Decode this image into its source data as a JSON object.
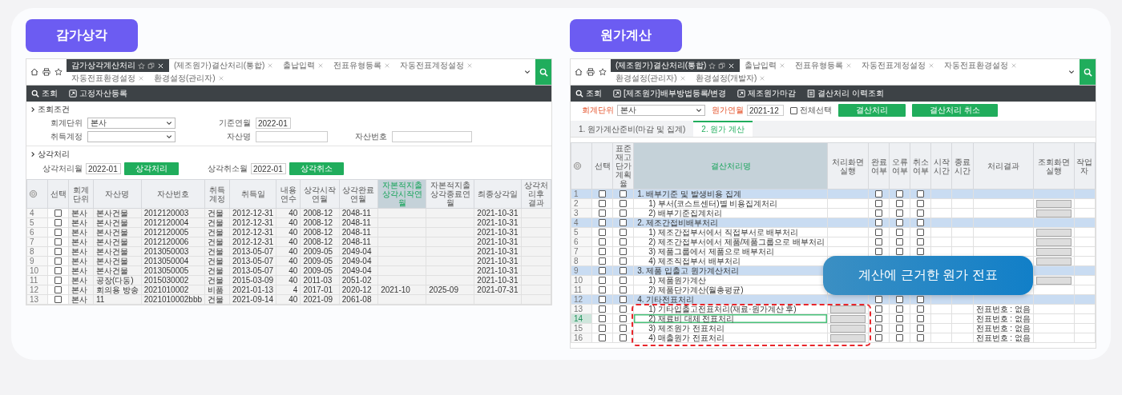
{
  "depreciation": {
    "title": "감가상각",
    "tabs": [
      {
        "label": "감가상각계산처리",
        "selected": true
      },
      {
        "label": "(제조원가)결산처리(통합)",
        "selected": false
      },
      {
        "label": "출납입력",
        "selected": false
      },
      {
        "label": "전표유형등록",
        "selected": false
      },
      {
        "label": "자동전표계정설정",
        "selected": false
      },
      {
        "label": "자동전표환경설정",
        "selected": false
      },
      {
        "label": "환경설정(관리자)",
        "selected": false
      }
    ],
    "toolbar": [
      {
        "kind": "search",
        "label": "조회"
      },
      {
        "kind": "form",
        "label": "고정자산등록"
      }
    ],
    "query": {
      "heading": "조회조건",
      "rows": [
        [
          {
            "label": "회계단위",
            "kind": "select",
            "value": "본사"
          },
          {
            "label": "기준연월",
            "kind": "input",
            "value": "2022-01"
          }
        ],
        [
          {
            "label": "취득계정",
            "kind": "select"
          },
          {
            "label": "자산명",
            "kind": "input"
          },
          {
            "label": "자산번호",
            "kind": "input"
          }
        ]
      ]
    },
    "process": {
      "heading": "상각처리",
      "fields": [
        {
          "label": "상각처리월",
          "value": "2022-01",
          "button": "상각처리"
        },
        {
          "label": "상각취소월",
          "value": "2022-01",
          "button": "상각취소"
        }
      ]
    },
    "table": {
      "select_header": "선택",
      "columns": [
        {
          "label": "회계단위",
          "highlighted": false
        },
        {
          "label": "자산명",
          "highlighted": false
        },
        {
          "label": "자산번호",
          "highlighted": false
        },
        {
          "label": "취득계정",
          "highlighted": false
        },
        {
          "label": "취득일",
          "highlighted": false
        },
        {
          "label": "내용연수",
          "highlighted": false
        },
        {
          "label": "상각시작연월",
          "highlighted": false
        },
        {
          "label": "상각완료연월",
          "highlighted": false
        },
        {
          "label": "자본적지출 상각시작연월",
          "highlighted": true
        },
        {
          "label": "자본적지출 상각종료연월",
          "highlighted": false
        },
        {
          "label": "최종상각일",
          "highlighted": false
        },
        {
          "label": "상각처리후 결과",
          "highlighted": false
        }
      ],
      "rows": [
        {
          "no": "4",
          "checked": false,
          "cells": [
            "본사",
            "본사건물",
            "2012120003",
            "건물",
            "2012-12-31",
            "40",
            "2008-12",
            "2048-11",
            null,
            null,
            "2021-10-31",
            null
          ]
        },
        {
          "no": "5",
          "checked": false,
          "cells": [
            "본사",
            "본사건물",
            "2012120004",
            "건물",
            "2012-12-31",
            "40",
            "2008-12",
            "2048-11",
            null,
            null,
            "2021-10-31",
            null
          ]
        },
        {
          "no": "6",
          "checked": false,
          "cells": [
            "본사",
            "본사건물",
            "2012120005",
            "건물",
            "2012-12-31",
            "40",
            "2008-12",
            "2048-11",
            null,
            null,
            "2021-10-31",
            null
          ]
        },
        {
          "no": "7",
          "checked": false,
          "cells": [
            "본사",
            "본사건물",
            "2012120006",
            "건물",
            "2012-12-31",
            "40",
            "2008-12",
            "2048-11",
            null,
            null,
            "2021-10-31",
            null
          ]
        },
        {
          "no": "8",
          "checked": false,
          "cells": [
            "본사",
            "본사건물",
            "2013050003",
            "건물",
            "2013-05-07",
            "40",
            "2009-05",
            "2049-04",
            null,
            null,
            "2021-10-31",
            null
          ]
        },
        {
          "no": "9",
          "checked": false,
          "cells": [
            "본사",
            "본사건물",
            "2013050004",
            "건물",
            "2013-05-07",
            "40",
            "2009-05",
            "2049-04",
            null,
            null,
            "2021-10-31",
            null
          ]
        },
        {
          "no": "10",
          "checked": false,
          "cells": [
            "본사",
            "본사건물",
            "2013050005",
            "건물",
            "2013-05-07",
            "40",
            "2009-05",
            "2049-04",
            null,
            null,
            "2021-10-31",
            null
          ]
        },
        {
          "no": "11",
          "checked": false,
          "cells": [
            "본사",
            "공장(다동)",
            "2015030002",
            "건물",
            "2015-03-09",
            "40",
            "2011-03",
            "2051-02",
            null,
            null,
            "2021-10-31",
            null
          ]
        },
        {
          "no": "12",
          "checked": false,
          "cells": [
            "본사",
            "회의용 방송",
            "2021010002",
            "비품",
            "2021-01-13",
            "4",
            "2017-01",
            "2020-12",
            "2021-10",
            "2025-09",
            "2021-07-31",
            null
          ]
        },
        {
          "no": "13",
          "checked": false,
          "cells": [
            "본사",
            "11",
            "2021010002bbb",
            "건물",
            "2021-09-14",
            "40",
            "2021-09",
            "2061-08",
            null,
            null,
            null,
            null
          ]
        }
      ]
    }
  },
  "costing": {
    "title": "원가계산",
    "tabs": [
      {
        "label": "(제조원가)결산처리(통합)",
        "selected": true
      },
      {
        "label": "출납입력",
        "selected": false
      },
      {
        "label": "전표유형등록",
        "selected": false
      },
      {
        "label": "자동전표계정설정",
        "selected": false
      },
      {
        "label": "자동전표환경설정",
        "selected": false
      },
      {
        "label": "환경설정(관리자)",
        "selected": false
      },
      {
        "label": "환경설정(개발자)",
        "selected": false
      }
    ],
    "toolbar": [
      {
        "kind": "search",
        "label": "조회"
      },
      {
        "kind": "form",
        "label": "[제조원가]배부방법등록/변경"
      },
      {
        "kind": "form",
        "label": "제조원가마감"
      },
      {
        "kind": "list",
        "label": "결산처리 이력조회"
      }
    ],
    "filters": {
      "fields": [
        {
          "label": "회계단위",
          "kind": "select",
          "value": "본사",
          "required": true
        },
        {
          "label": "원가연월",
          "kind": "input",
          "value": "2021-12",
          "required": true
        }
      ],
      "select_all": {
        "label": "전체선택",
        "checked": false
      },
      "buttons": [
        "결산처리",
        "결산처리 취소"
      ]
    },
    "subtabs": [
      {
        "label": "1. 원가계산준비(마감 및 집계)",
        "selected": false
      },
      {
        "label": "2. 원가 계산",
        "selected": true
      }
    ],
    "table": {
      "columns": [
        {
          "label": "선택",
          "highlighted": false
        },
        {
          "label": "표준재고단가 계획율",
          "highlighted": false
        },
        {
          "label": "결산처리명",
          "highlighted": true
        },
        {
          "label": "처리화면실행",
          "highlighted": false
        },
        {
          "label": "완료여부",
          "highlighted": false
        },
        {
          "label": "오류여부",
          "highlighted": false
        },
        {
          "label": "취소여부",
          "highlighted": false
        },
        {
          "label": "시작시간",
          "highlighted": false
        },
        {
          "label": "종료시간",
          "highlighted": false
        },
        {
          "label": "처리결과",
          "highlighted": false
        },
        {
          "label": "조회화면실행",
          "highlighted": false
        },
        {
          "label": "작업자",
          "highlighted": false
        }
      ],
      "rows": [
        {
          "no": "1",
          "kind": "group",
          "label": "1. 배부기준 및 발생비용 집계",
          "selected": false,
          "select_checked": false,
          "plan_checked": false,
          "done": false,
          "error": false,
          "cancel": false,
          "run_button": false,
          "view_button": false
        },
        {
          "no": "2",
          "kind": "item",
          "label": "1) 부서(코스트센터)별 비용집계처리",
          "selected": false,
          "select_checked": false,
          "plan_checked": false,
          "done": false,
          "error": false,
          "cancel": false,
          "run_button": false,
          "view_button": true
        },
        {
          "no": "3",
          "kind": "item",
          "label": "2) 배부기준집계처리",
          "selected": false,
          "select_checked": false,
          "plan_checked": false,
          "done": false,
          "error": false,
          "cancel": false,
          "run_button": false,
          "view_button": true
        },
        {
          "no": "4",
          "kind": "group",
          "label": "2. 제조간접비배부처리",
          "selected": false,
          "select_checked": false,
          "plan_checked": false,
          "done": false,
          "error": false,
          "cancel": false,
          "run_button": false,
          "view_button": false
        },
        {
          "no": "5",
          "kind": "item",
          "label": "1) 제조간접부서에서 직접부서로 배부처리",
          "selected": false,
          "select_checked": false,
          "plan_checked": false,
          "done": false,
          "error": false,
          "cancel": false,
          "run_button": false,
          "view_button": true
        },
        {
          "no": "6",
          "kind": "item",
          "label": "2) 제조간접부서에서 제품/제품그룹으로 배부처리",
          "selected": false,
          "select_checked": false,
          "plan_checked": false,
          "done": false,
          "error": false,
          "cancel": false,
          "run_button": false,
          "view_button": true
        },
        {
          "no": "7",
          "kind": "item",
          "label": "3) 제품그룹에서 제품으로 배부처리",
          "selected": false,
          "select_checked": false,
          "plan_checked": false,
          "done": false,
          "error": false,
          "cancel": false,
          "run_button": false,
          "view_button": true
        },
        {
          "no": "8",
          "kind": "item",
          "label": "4) 제조직접부서 배부처리",
          "selected": false,
          "select_checked": false,
          "plan_checked": false,
          "run_button": false,
          "view_button": true
        },
        {
          "no": "9",
          "kind": "group",
          "label": "3. 제품 입출고 원가계산처리",
          "selected": false,
          "select_checked": false,
          "plan_checked": false,
          "run_button": false,
          "view_button": false
        },
        {
          "no": "10",
          "kind": "item",
          "label": "1) 제품원가계산",
          "selected": false,
          "select_checked": false,
          "plan_checked": false,
          "run_button": false,
          "view_button": true
        },
        {
          "no": "11",
          "kind": "item",
          "label": "2) 제품단가계산(월총평균)",
          "selected": false,
          "select_checked": false,
          "plan_checked": false,
          "run_button": false,
          "view_button": false
        },
        {
          "no": "12",
          "kind": "group",
          "label": "4. 기타전표처리",
          "selected": false,
          "select_checked": false,
          "plan_checked": false,
          "done": false,
          "error": false,
          "cancel": false,
          "run_button": false,
          "view_button": false
        },
        {
          "no": "13",
          "kind": "item",
          "label": "1) 기타입출고전표처리(재료·원가계산 후)",
          "selected": false,
          "select_checked": false,
          "plan_checked": false,
          "done": false,
          "error": false,
          "cancel": false,
          "run_button": true,
          "view_button": false,
          "result": "전표번호 : 없음"
        },
        {
          "no": "14",
          "kind": "item",
          "label": "2) 재료비 대체 전표처리",
          "selected": true,
          "select_checked": false,
          "plan_checked": false,
          "done": false,
          "error": false,
          "cancel": false,
          "run_button": true,
          "view_button": false,
          "result": "전표번호 : 없음"
        },
        {
          "no": "15",
          "kind": "item",
          "label": "3) 제조원가 전표처리",
          "selected": false,
          "select_checked": false,
          "plan_checked": false,
          "done": false,
          "error": false,
          "cancel": false,
          "run_button": true,
          "view_button": false,
          "result": "전표번호 : 없음"
        },
        {
          "no": "16",
          "kind": "item",
          "label": "4) 매출원가 전표처리",
          "selected": false,
          "select_checked": false,
          "plan_checked": false,
          "done": false,
          "error": false,
          "cancel": false,
          "run_button": true,
          "view_button": false,
          "result": "전표번호 : 없음"
        }
      ]
    },
    "callout": "계산에 근거한 원가 전표"
  }
}
